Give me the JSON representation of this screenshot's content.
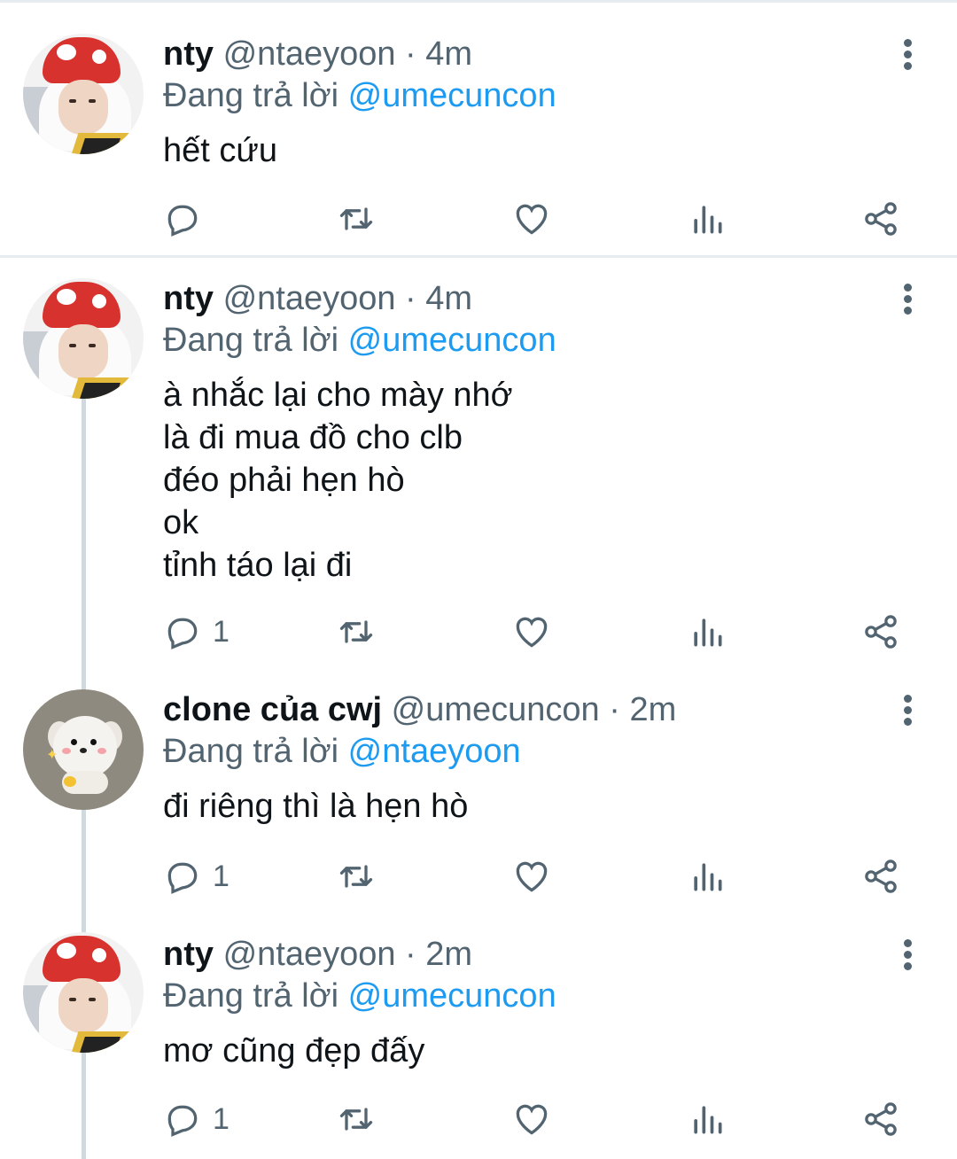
{
  "tweets": [
    {
      "name": "nty",
      "handle": "@ntaeyoon · 4m",
      "reply_prefix": "Đang trả lời ",
      "reply_to": "@umecuncon",
      "text": "hết cứu",
      "reply_count": "",
      "avatar_icon": "mushroom-hat-avatar"
    },
    {
      "name": "nty",
      "handle": "@ntaeyoon · 4m",
      "reply_prefix": "Đang trả lời ",
      "reply_to": "@umecuncon",
      "text": "à nhắc lại cho mày nhớ\nlà đi mua đồ cho clb\nđéo phải hẹn hò\nok\ntỉnh táo lại đi",
      "reply_count": "1",
      "avatar_icon": "mushroom-hat-avatar"
    },
    {
      "name": "clone của cwj",
      "handle": "@umecuncon · 2m",
      "reply_prefix": "Đang trả lời ",
      "reply_to": "@ntaeyoon",
      "text": "đi riêng thì là hẹn hò",
      "reply_count": "1",
      "avatar_icon": "white-puppy-avatar"
    },
    {
      "name": "nty",
      "handle": "@ntaeyoon · 2m",
      "reply_prefix": "Đang trả lời ",
      "reply_to": "@umecuncon",
      "text": "mơ cũng đẹp đấy",
      "reply_count": "1",
      "avatar_icon": "mushroom-hat-avatar"
    }
  ],
  "colors": {
    "mention": "#1d9bf0",
    "secondary_text": "#536471",
    "divider": "#e6ecf0"
  }
}
